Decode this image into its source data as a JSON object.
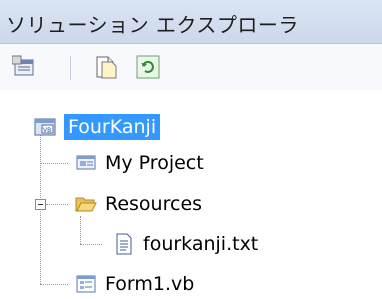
{
  "window": {
    "title": "ソリューション エクスプローラ"
  },
  "toolbar": {
    "buttons": [
      {
        "name": "properties-button",
        "icon": "properties-icon"
      },
      {
        "name": "show-all-files-button",
        "icon": "show-all-files-icon"
      },
      {
        "name": "refresh-button",
        "icon": "refresh-icon"
      }
    ]
  },
  "tree": {
    "project": {
      "label": "FourKanji",
      "icon": "vb-project-icon"
    },
    "items": [
      {
        "label": "My Project",
        "icon": "my-project-icon"
      },
      {
        "label": "Resources",
        "icon": "folder-open-icon",
        "expanded": true
      },
      {
        "label": "fourkanji.txt",
        "icon": "text-file-icon"
      },
      {
        "label": "Form1.vb",
        "icon": "form-icon"
      }
    ]
  },
  "colors": {
    "selection": "#3399ff",
    "title_bg": "#cbd8eb"
  }
}
